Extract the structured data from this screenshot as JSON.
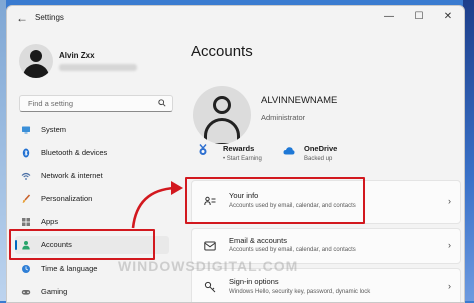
{
  "window": {
    "title": "Settings",
    "controls": [
      "minimize",
      "maximize",
      "close"
    ]
  },
  "sidebar": {
    "user_name": "Alvin Zxx",
    "search": {
      "placeholder": "Find a setting"
    },
    "items": [
      {
        "label": "System",
        "icon": "monitor-icon",
        "active": false
      },
      {
        "label": "Bluetooth & devices",
        "icon": "bluetooth-icon",
        "active": false
      },
      {
        "label": "Network & internet",
        "icon": "wifi-icon",
        "active": false
      },
      {
        "label": "Personalization",
        "icon": "brush-icon",
        "active": false
      },
      {
        "label": "Apps",
        "icon": "apps-icon",
        "active": false
      },
      {
        "label": "Accounts",
        "icon": "person-icon",
        "active": true
      },
      {
        "label": "Time & language",
        "icon": "globe-clock-icon",
        "active": false
      },
      {
        "label": "Gaming",
        "icon": "controller-icon",
        "active": false
      }
    ]
  },
  "main": {
    "title": "Accounts",
    "account_name": "ALVINNEWNAME",
    "account_role": "Administrator",
    "stats": [
      {
        "title": "Rewards",
        "subtitle": "• Start Earning",
        "icon": "rewards-icon"
      },
      {
        "title": "OneDrive",
        "subtitle": "Backed up",
        "icon": "cloud-icon"
      }
    ],
    "cards": [
      {
        "title": "Your info",
        "subtitle": "Accounts used by email, calendar, and contacts",
        "icon": "contact-card-icon"
      },
      {
        "title": "Email & accounts",
        "subtitle": "Accounts used by email, calendar, and contacts",
        "icon": "envelope-icon"
      },
      {
        "title": "Sign-in options",
        "subtitle": "Windows Hello, security key, password, dynamic lock",
        "icon": "key-icon"
      }
    ]
  },
  "annotation": {
    "color": "#d2181e"
  },
  "watermark": "WINDOWSDIGITAL.COM",
  "colors": {
    "accent": "#0067c0",
    "window_bg": "#f3f3f3",
    "card_bg": "#fbfbfb"
  }
}
